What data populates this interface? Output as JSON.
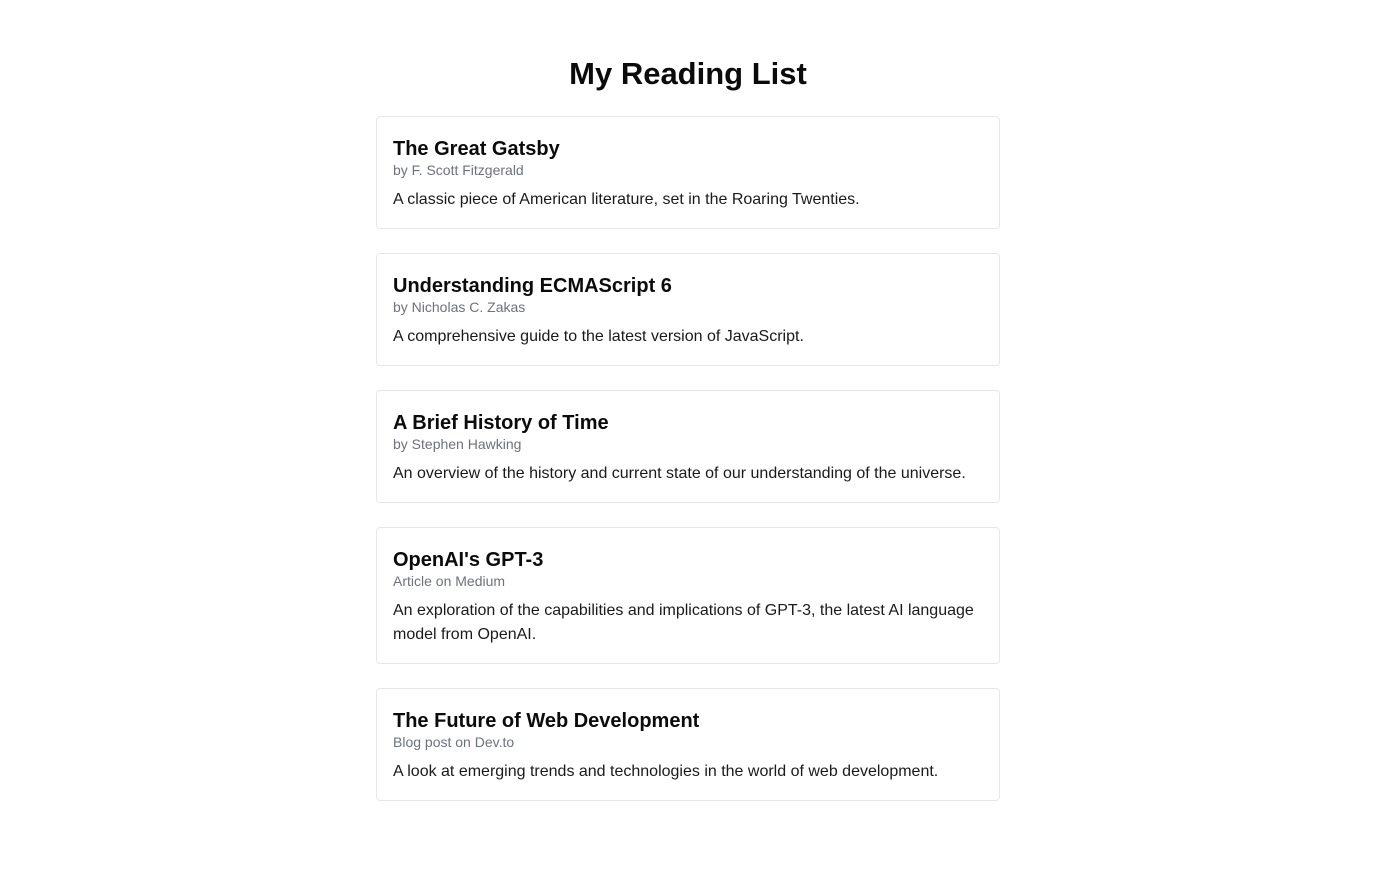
{
  "page": {
    "title": "My Reading List"
  },
  "items": [
    {
      "title": "The Great Gatsby",
      "source": "by F. Scott Fitzgerald",
      "description": "A classic piece of American literature, set in the Roaring Twenties."
    },
    {
      "title": "Understanding ECMAScript 6",
      "source": "by Nicholas C. Zakas",
      "description": "A comprehensive guide to the latest version of JavaScript."
    },
    {
      "title": "A Brief History of Time",
      "source": "by Stephen Hawking",
      "description": "An overview of the history and current state of our understanding of the universe."
    },
    {
      "title": "OpenAI's GPT-3",
      "source": "Article on Medium",
      "description": "An exploration of the capabilities and implications of GPT-3, the latest AI language model from OpenAI."
    },
    {
      "title": "The Future of Web Development",
      "source": "Blog post on Dev.to",
      "description": "A look at emerging trends and technologies in the world of web development."
    }
  ],
  "colors": {
    "background": "#ffffff",
    "card_border": "#e5e7eb",
    "title_text": "#0b0b0b",
    "secondary_text": "#6b7280"
  }
}
